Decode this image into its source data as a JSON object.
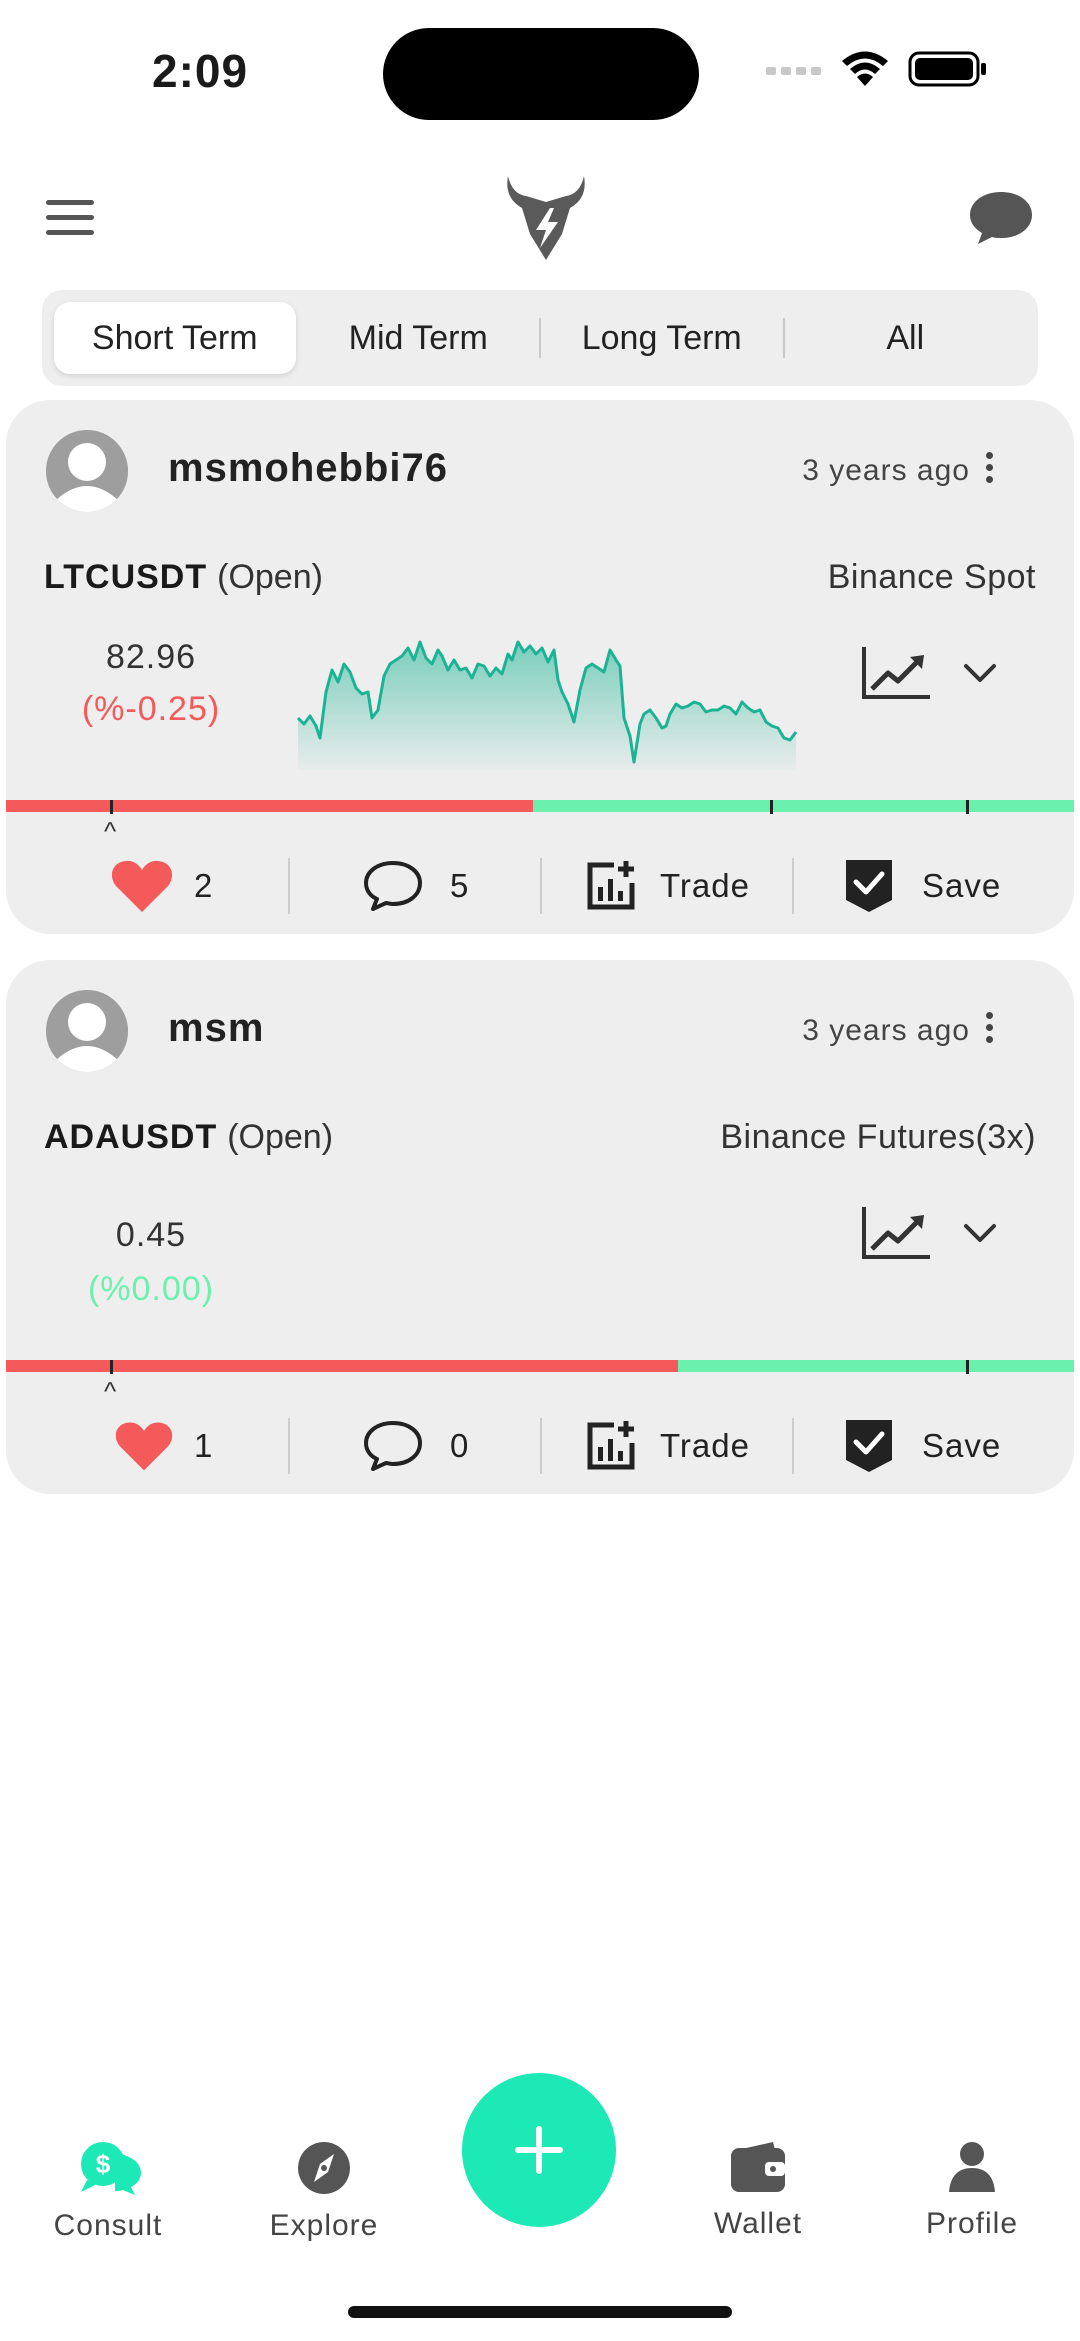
{
  "status": {
    "time": "2:09"
  },
  "tabs": [
    {
      "label": "Short Term",
      "active": true
    },
    {
      "label": "Mid Term",
      "active": false
    },
    {
      "label": "Long Term",
      "active": false
    },
    {
      "label": "All",
      "active": false
    }
  ],
  "posts": [
    {
      "username": "msmohebbi76",
      "time_ago": "3 years ago",
      "pair": "LTCUSDT",
      "state": "(Open)",
      "exchange": "Binance Spot",
      "price": "82.96",
      "change": "(%-0.25)",
      "likes": "2",
      "comments": "5",
      "trade_label": "Trade",
      "save_label": "Save",
      "caret": "^",
      "progress_red_fraction": 0.5
    },
    {
      "username": "msm",
      "time_ago": "3 years ago",
      "pair": "ADAUSDT",
      "state": "(Open)",
      "exchange": "Binance Futures(3x)",
      "price": "0.45",
      "change": "(%0.00)",
      "likes": "1",
      "comments": "0",
      "trade_label": "Trade",
      "save_label": "Save",
      "caret": "^",
      "progress_red_fraction": 0.635
    }
  ],
  "colors": {
    "negative": "#f45a5a",
    "positive": "#6cf0ad",
    "accent": "#1de9b6",
    "sparkline": "#1ab394"
  },
  "nav": {
    "consult": "Consult",
    "explore": "Explore",
    "wallet": "Wallet",
    "profile": "Profile"
  }
}
